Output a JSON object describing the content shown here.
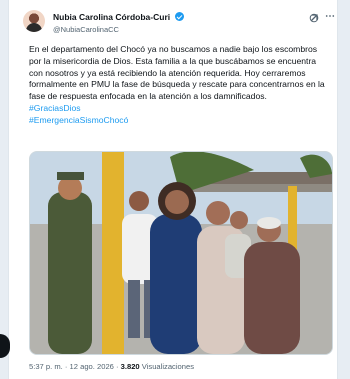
{
  "post": {
    "author_name": "Nubia Carolina Córdoba-Curi",
    "handle": "@NubiaCarolinaCC",
    "text": "En el departamento del Chocó ya no buscamos a nadie bajo los escombros por la misericordia de Dios. Esta familia a la que buscábamos se encuentra con nosotros y ya está recibiendo la atención requerida. Hoy cerraremos formalmente en PMU la fase de búsqueda y rescate para concentrarnos en la fase de respuesta enfocada en la atención a los damnificados.",
    "hashtags": [
      "#GraciasDios",
      "#EmergenciaSismoChocó"
    ],
    "time": "5:37 p. m.",
    "date": "12 ago. 2026",
    "views_count": "3.820",
    "views_label": "Visualizaciones"
  },
  "colors": {
    "accent": "#1d9bf0",
    "text": "#0f1419",
    "muted": "#536471"
  },
  "icons": [
    "verified-badge-icon",
    "grok-icon",
    "more-icon"
  ]
}
